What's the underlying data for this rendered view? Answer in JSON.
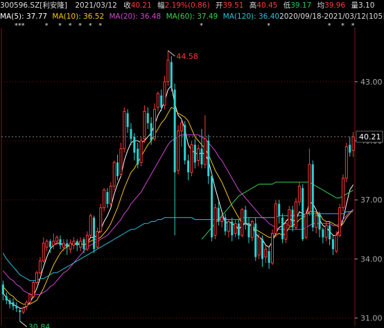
{
  "header": {
    "code": "300596.SZ[利安隆]",
    "date": "2021/03/12",
    "close_label": "收",
    "close": "40.21",
    "amp_label": "幅",
    "amp": "2.19%(0.86)",
    "open_label": "开",
    "open": "39.51",
    "high_label": "高",
    "high": "40.45",
    "low_label": "低",
    "low": "39.17",
    "avg_label": "均",
    "avg": "39.96",
    "vol_label": "量",
    "vol": "3.10"
  },
  "ma_legend": [
    {
      "label": "MA(5): 37.77",
      "color": "#ffffff"
    },
    {
      "label": "MA(10): 36.52",
      "color": "#f5c518"
    },
    {
      "label": "MA(20): 36.48",
      "color": "#d147d1"
    },
    {
      "label": "MA(60): 37.49",
      "color": "#39d353"
    },
    {
      "label": "MA(120): 36.40",
      "color": "#2fc0d9"
    }
  ],
  "range_label": "2020/09/18-2021/03/12(105日)",
  "colors": {
    "up": "#ff3b3b",
    "down": "#2ed3d3",
    "grid": "#7a1a1a",
    "axis": "#aaaaaa"
  },
  "chart_data": {
    "type": "candlestick",
    "title": "300596.SZ[利安隆]",
    "date_range": [
      "2020/09/18",
      "2021/03/12"
    ],
    "ylim": [
      30.6,
      45.6
    ],
    "y_ticks": [
      31.0,
      34.0,
      37.0,
      40.0,
      43.0
    ],
    "y_tick_labels": [
      "31.00",
      "34.00",
      "37.00",
      "40.00",
      "43.00"
    ],
    "last_price_label": "40.21",
    "last_price": 40.21,
    "max_label": "44.58",
    "max_value": 44.58,
    "min_label": "30.84",
    "min_value": 30.84,
    "candles": [
      [
        32.7,
        32.2,
        32.9,
        31.9
      ],
      [
        32.1,
        31.9,
        32.3,
        31.7
      ],
      [
        31.9,
        31.7,
        32.0,
        31.5
      ],
      [
        31.8,
        31.6,
        32.0,
        31.4
      ],
      [
        31.6,
        31.5,
        31.8,
        31.3
      ],
      [
        31.4,
        31.3,
        31.5,
        30.84
      ],
      [
        31.3,
        31.5,
        31.6,
        31.2
      ],
      [
        31.6,
        31.8,
        31.9,
        31.4
      ],
      [
        31.8,
        32.2,
        32.3,
        31.7
      ],
      [
        32.1,
        32.8,
        32.9,
        32.0
      ],
      [
        32.8,
        33.3,
        33.4,
        32.7
      ],
      [
        33.3,
        33.9,
        34.1,
        33.2
      ],
      [
        33.9,
        34.8,
        35.1,
        33.8
      ],
      [
        34.6,
        34.9,
        35.0,
        34.4
      ],
      [
        34.9,
        34.6,
        35.0,
        34.3
      ],
      [
        34.7,
        34.9,
        35.3,
        34.5
      ],
      [
        34.9,
        35.1,
        35.2,
        34.7
      ],
      [
        35.0,
        34.7,
        35.2,
        34.5
      ],
      [
        34.6,
        34.8,
        35.0,
        34.4
      ],
      [
        34.8,
        34.6,
        35.0,
        34.2
      ],
      [
        34.5,
        34.8,
        35.0,
        34.3
      ],
      [
        34.7,
        34.9,
        35.1,
        34.5
      ],
      [
        34.9,
        34.7,
        35.0,
        34.4
      ],
      [
        34.6,
        34.9,
        35.1,
        34.4
      ],
      [
        35.0,
        34.5,
        35.1,
        34.3
      ],
      [
        34.5,
        35.2,
        35.4,
        34.4
      ],
      [
        35.2,
        36.2,
        36.3,
        35.1
      ],
      [
        36.1,
        34.5,
        36.2,
        34.3
      ],
      [
        34.6,
        35.4,
        35.6,
        34.5
      ],
      [
        35.4,
        36.6,
        36.8,
        35.3
      ],
      [
        36.6,
        37.5,
        37.6,
        36.4
      ],
      [
        37.4,
        36.8,
        37.6,
        36.6
      ],
      [
        36.8,
        37.7,
        37.9,
        36.7
      ],
      [
        37.7,
        38.9,
        39.0,
        37.5
      ],
      [
        38.9,
        38.2,
        39.3,
        38.0
      ],
      [
        38.3,
        39.6,
        39.9,
        38.2
      ],
      [
        39.6,
        41.5,
        41.7,
        39.4
      ],
      [
        41.4,
        40.7,
        41.6,
        40.4
      ],
      [
        40.6,
        40.1,
        40.9,
        39.8
      ],
      [
        40.2,
        39.4,
        40.4,
        39.0
      ],
      [
        39.6,
        38.8,
        39.9,
        38.6
      ],
      [
        38.9,
        40.0,
        40.2,
        38.7
      ],
      [
        40.1,
        41.5,
        41.8,
        39.9
      ],
      [
        41.4,
        40.9,
        41.7,
        40.6
      ],
      [
        40.9,
        40.0,
        41.2,
        39.8
      ],
      [
        40.1,
        41.6,
        41.9,
        40.0
      ],
      [
        41.7,
        42.4,
        42.5,
        41.5
      ],
      [
        42.3,
        41.7,
        42.6,
        41.5
      ],
      [
        41.8,
        43.0,
        43.3,
        41.6
      ],
      [
        43.0,
        44.1,
        44.58,
        42.8
      ],
      [
        44.0,
        42.7,
        44.3,
        42.5
      ],
      [
        42.6,
        38.4,
        42.9,
        35.2
      ],
      [
        38.5,
        40.5,
        40.8,
        38.3
      ],
      [
        40.5,
        40.9,
        41.1,
        39.7
      ],
      [
        40.8,
        39.0,
        41.0,
        38.8
      ],
      [
        39.0,
        38.4,
        39.3,
        38.0
      ],
      [
        38.4,
        39.8,
        40.0,
        38.2
      ],
      [
        39.8,
        38.9,
        40.1,
        38.6
      ],
      [
        39.0,
        39.6,
        39.8,
        38.7
      ],
      [
        39.6,
        38.8,
        40.6,
        38.6
      ],
      [
        38.8,
        40.1,
        41.3,
        38.6
      ],
      [
        40.0,
        38.2,
        40.3,
        37.8
      ],
      [
        38.2,
        35.1,
        38.4,
        34.9
      ],
      [
        35.2,
        36.6,
        36.8,
        35.0
      ],
      [
        36.6,
        35.9,
        36.9,
        35.7
      ],
      [
        35.9,
        36.1,
        36.3,
        35.6
      ],
      [
        36.1,
        35.4,
        36.3,
        35.2
      ],
      [
        35.4,
        35.9,
        36.0,
        35.1
      ],
      [
        35.9,
        35.2,
        36.1,
        34.9
      ],
      [
        35.3,
        35.8,
        36.0,
        35.1
      ],
      [
        35.8,
        35.2,
        36.0,
        35.0
      ],
      [
        35.2,
        36.5,
        36.6,
        35.1
      ],
      [
        36.5,
        35.8,
        36.7,
        35.5
      ],
      [
        35.8,
        35.1,
        36.1,
        34.8
      ],
      [
        35.1,
        35.9,
        36.0,
        34.9
      ],
      [
        35.8,
        34.1,
        36.1,
        33.9
      ],
      [
        34.2,
        35.1,
        35.3,
        34.0
      ],
      [
        35.0,
        34.0,
        35.2,
        33.6
      ],
      [
        34.1,
        34.5,
        34.7,
        33.8
      ],
      [
        34.4,
        33.8,
        34.6,
        33.5
      ],
      [
        33.8,
        35.3,
        35.5,
        33.7
      ],
      [
        35.3,
        36.8,
        37.0,
        35.1
      ],
      [
        36.8,
        36.2,
        37.0,
        35.8
      ],
      [
        36.1,
        35.0,
        36.3,
        34.8
      ],
      [
        35.0,
        35.8,
        36.0,
        34.8
      ],
      [
        35.7,
        36.5,
        36.7,
        35.6
      ],
      [
        36.5,
        35.6,
        36.7,
        35.4
      ],
      [
        35.6,
        36.9,
        37.1,
        35.5
      ],
      [
        36.9,
        37.7,
        37.9,
        36.7
      ],
      [
        37.6,
        35.0,
        37.8,
        34.9
      ],
      [
        35.1,
        36.3,
        36.5,
        35.0
      ],
      [
        36.4,
        38.8,
        39.6,
        36.2
      ],
      [
        38.8,
        35.6,
        39.0,
        35.4
      ],
      [
        35.6,
        36.2,
        36.4,
        35.3
      ],
      [
        36.3,
        35.5,
        36.4,
        35.1
      ],
      [
        35.5,
        35.1,
        35.6,
        34.8
      ],
      [
        35.1,
        35.7,
        35.9,
        34.9
      ],
      [
        35.7,
        35.0,
        35.9,
        34.7
      ],
      [
        35.0,
        34.5,
        35.2,
        34.2
      ],
      [
        34.4,
        35.2,
        35.4,
        34.3
      ],
      [
        35.2,
        36.6,
        36.8,
        35.1
      ],
      [
        36.6,
        38.1,
        38.3,
        36.4
      ],
      [
        38.1,
        39.7,
        39.9,
        37.9
      ],
      [
        39.8,
        39.4,
        40.2,
        39.2
      ],
      [
        39.51,
        40.21,
        40.45,
        39.17
      ]
    ],
    "ma_lines": {
      "MA5": [
        32.3,
        32.0,
        31.8,
        31.7,
        31.6,
        31.5,
        31.5,
        31.6,
        31.8,
        32.1,
        32.5,
        33.0,
        33.6,
        34.1,
        34.5,
        34.7,
        34.8,
        34.8,
        34.7,
        34.7,
        34.7,
        34.8,
        34.7,
        34.8,
        34.7,
        34.8,
        35.1,
        35.1,
        35.2,
        35.5,
        35.9,
        36.2,
        36.6,
        37.3,
        37.8,
        38.2,
        39.0,
        39.5,
        39.9,
        40.0,
        40.0,
        39.9,
        40.0,
        40.2,
        40.4,
        40.8,
        41.3,
        41.6,
        42.0,
        42.6,
        42.8,
        41.9,
        41.3,
        41.1,
        40.6,
        39.8,
        39.5,
        39.4,
        39.3,
        39.4,
        39.3,
        39.0,
        38.3,
        37.6,
        37.0,
        36.4,
        35.8,
        35.9,
        35.8,
        35.7,
        35.5,
        35.7,
        35.8,
        35.7,
        35.7,
        35.3,
        35.1,
        35.0,
        34.7,
        34.6,
        34.9,
        35.3,
        35.6,
        35.7,
        35.9,
        36.1,
        35.9,
        36.0,
        36.4,
        36.3,
        36.2,
        36.9,
        36.8,
        36.5,
        36.0,
        35.7,
        35.6,
        35.4,
        35.2,
        35.2,
        35.5,
        36.0,
        36.8,
        37.5,
        37.77
      ],
      "MA10": [
        32.6,
        32.4,
        32.2,
        32.1,
        31.9,
        31.8,
        31.7,
        31.7,
        31.7,
        31.8,
        31.9,
        32.2,
        32.5,
        32.9,
        33.3,
        33.7,
        34.0,
        34.3,
        34.5,
        34.6,
        34.7,
        34.8,
        34.8,
        34.8,
        34.7,
        34.8,
        34.9,
        35.0,
        35.0,
        35.1,
        35.3,
        35.5,
        35.8,
        36.2,
        36.6,
        37.1,
        37.6,
        38.0,
        38.4,
        38.6,
        38.9,
        39.2,
        39.5,
        39.8,
        40.0,
        40.3,
        40.6,
        40.9,
        41.1,
        41.4,
        41.7,
        41.6,
        41.4,
        41.3,
        41.2,
        41.0,
        40.6,
        40.2,
        40.0,
        39.8,
        39.6,
        39.3,
        38.9,
        38.5,
        38.2,
        37.9,
        37.5,
        37.1,
        36.7,
        36.4,
        36.1,
        35.8,
        35.8,
        35.8,
        35.7,
        35.5,
        35.4,
        35.3,
        35.2,
        35.1,
        35.1,
        35.2,
        35.3,
        35.2,
        35.3,
        35.6,
        35.7,
        35.8,
        36.0,
        36.1,
        36.2,
        36.4,
        36.4,
        36.4,
        36.3,
        36.0,
        35.9,
        35.9,
        35.8,
        35.7,
        35.6,
        35.8,
        36.1,
        36.3,
        36.52
      ],
      "MA20": [
        33.4,
        33.2,
        33.0,
        32.9,
        32.7,
        32.6,
        32.4,
        32.3,
        32.2,
        32.2,
        32.2,
        32.2,
        32.3,
        32.4,
        32.6,
        32.7,
        32.9,
        33.1,
        33.3,
        33.4,
        33.6,
        33.8,
        34.0,
        34.2,
        34.4,
        34.6,
        34.7,
        34.8,
        34.9,
        35.0,
        35.1,
        35.2,
        35.4,
        35.6,
        35.8,
        36.0,
        36.3,
        36.5,
        36.8,
        37.0,
        37.2,
        37.4,
        37.7,
        38.0,
        38.3,
        38.6,
        38.9,
        39.2,
        39.5,
        39.8,
        40.0,
        40.1,
        40.2,
        40.3,
        40.3,
        40.3,
        40.3,
        40.3,
        40.3,
        40.2,
        40.1,
        39.9,
        39.7,
        39.5,
        39.2,
        39.0,
        38.7,
        38.4,
        38.1,
        37.8,
        37.5,
        37.3,
        37.1,
        36.9,
        36.7,
        36.5,
        36.3,
        36.1,
        36.0,
        35.8,
        35.7,
        35.6,
        35.5,
        35.5,
        35.5,
        35.5,
        35.5,
        35.5,
        35.5,
        35.5,
        35.6,
        35.7,
        35.8,
        35.8,
        35.8,
        35.8,
        35.8,
        35.8,
        35.7,
        35.7,
        35.8,
        36.0,
        36.2,
        36.4,
        36.48
      ],
      "MA60": [
        null,
        null,
        null,
        null,
        null,
        null,
        null,
        null,
        null,
        null,
        null,
        null,
        null,
        null,
        null,
        null,
        null,
        null,
        null,
        null,
        null,
        null,
        null,
        null,
        null,
        null,
        null,
        null,
        null,
        null,
        null,
        null,
        null,
        null,
        null,
        null,
        null,
        null,
        null,
        null,
        null,
        null,
        null,
        null,
        null,
        null,
        null,
        null,
        null,
        null,
        null,
        null,
        null,
        null,
        null,
        null,
        null,
        null,
        null,
        35.0,
        35.2,
        35.4,
        35.6,
        35.8,
        36.0,
        36.2,
        36.4,
        36.6,
        36.8,
        37.0,
        37.2,
        37.3,
        37.4,
        37.5,
        37.6,
        37.7,
        37.8,
        37.8,
        37.8,
        37.8,
        37.8,
        37.9,
        37.9,
        37.9,
        37.9,
        37.9,
        37.9,
        37.9,
        37.9,
        37.9,
        37.9,
        37.9,
        37.8,
        37.7,
        37.6,
        37.5,
        37.4,
        37.3,
        37.2,
        37.1,
        37.1,
        37.2,
        37.3,
        37.4,
        37.49
      ],
      "MA120": [
        34.3,
        34.0,
        33.8,
        33.6,
        33.4,
        33.2,
        33.1,
        33.0,
        32.9,
        32.9,
        32.9,
        33.0,
        33.0,
        33.1,
        33.2,
        33.3,
        33.3,
        33.4,
        33.5,
        33.6,
        33.7,
        33.8,
        33.9,
        34.0,
        34.1,
        34.2,
        34.3,
        34.4,
        34.5,
        34.6,
        34.7,
        34.8,
        34.9,
        35.0,
        35.1,
        35.2,
        35.3,
        35.4,
        35.5,
        35.5,
        35.6,
        35.7,
        35.8,
        35.8,
        35.9,
        35.9,
        36.0,
        36.0,
        36.1,
        36.1,
        36.1,
        36.1,
        36.1,
        36.1,
        36.1,
        36.1,
        36.1,
        36.0,
        36.0,
        36.0,
        36.0,
        36.0,
        36.0,
        36.0,
        36.0,
        36.0,
        36.0,
        36.0,
        36.0,
        36.0,
        36.0,
        36.1,
        36.1,
        36.1,
        36.1,
        36.1,
        36.1,
        36.1,
        36.1,
        36.1,
        36.1,
        36.1,
        36.2,
        36.2,
        36.2,
        36.2,
        36.2,
        36.2,
        36.2,
        36.2,
        36.3,
        36.3,
        36.3,
        36.3,
        36.3,
        36.3,
        36.3,
        36.3,
        36.3,
        36.3,
        36.3,
        36.3,
        36.4,
        36.4,
        36.4
      ]
    },
    "star_markers": [
      4,
      5,
      6,
      13,
      17,
      20,
      23,
      26,
      29,
      59,
      79,
      97,
      101,
      104
    ]
  }
}
